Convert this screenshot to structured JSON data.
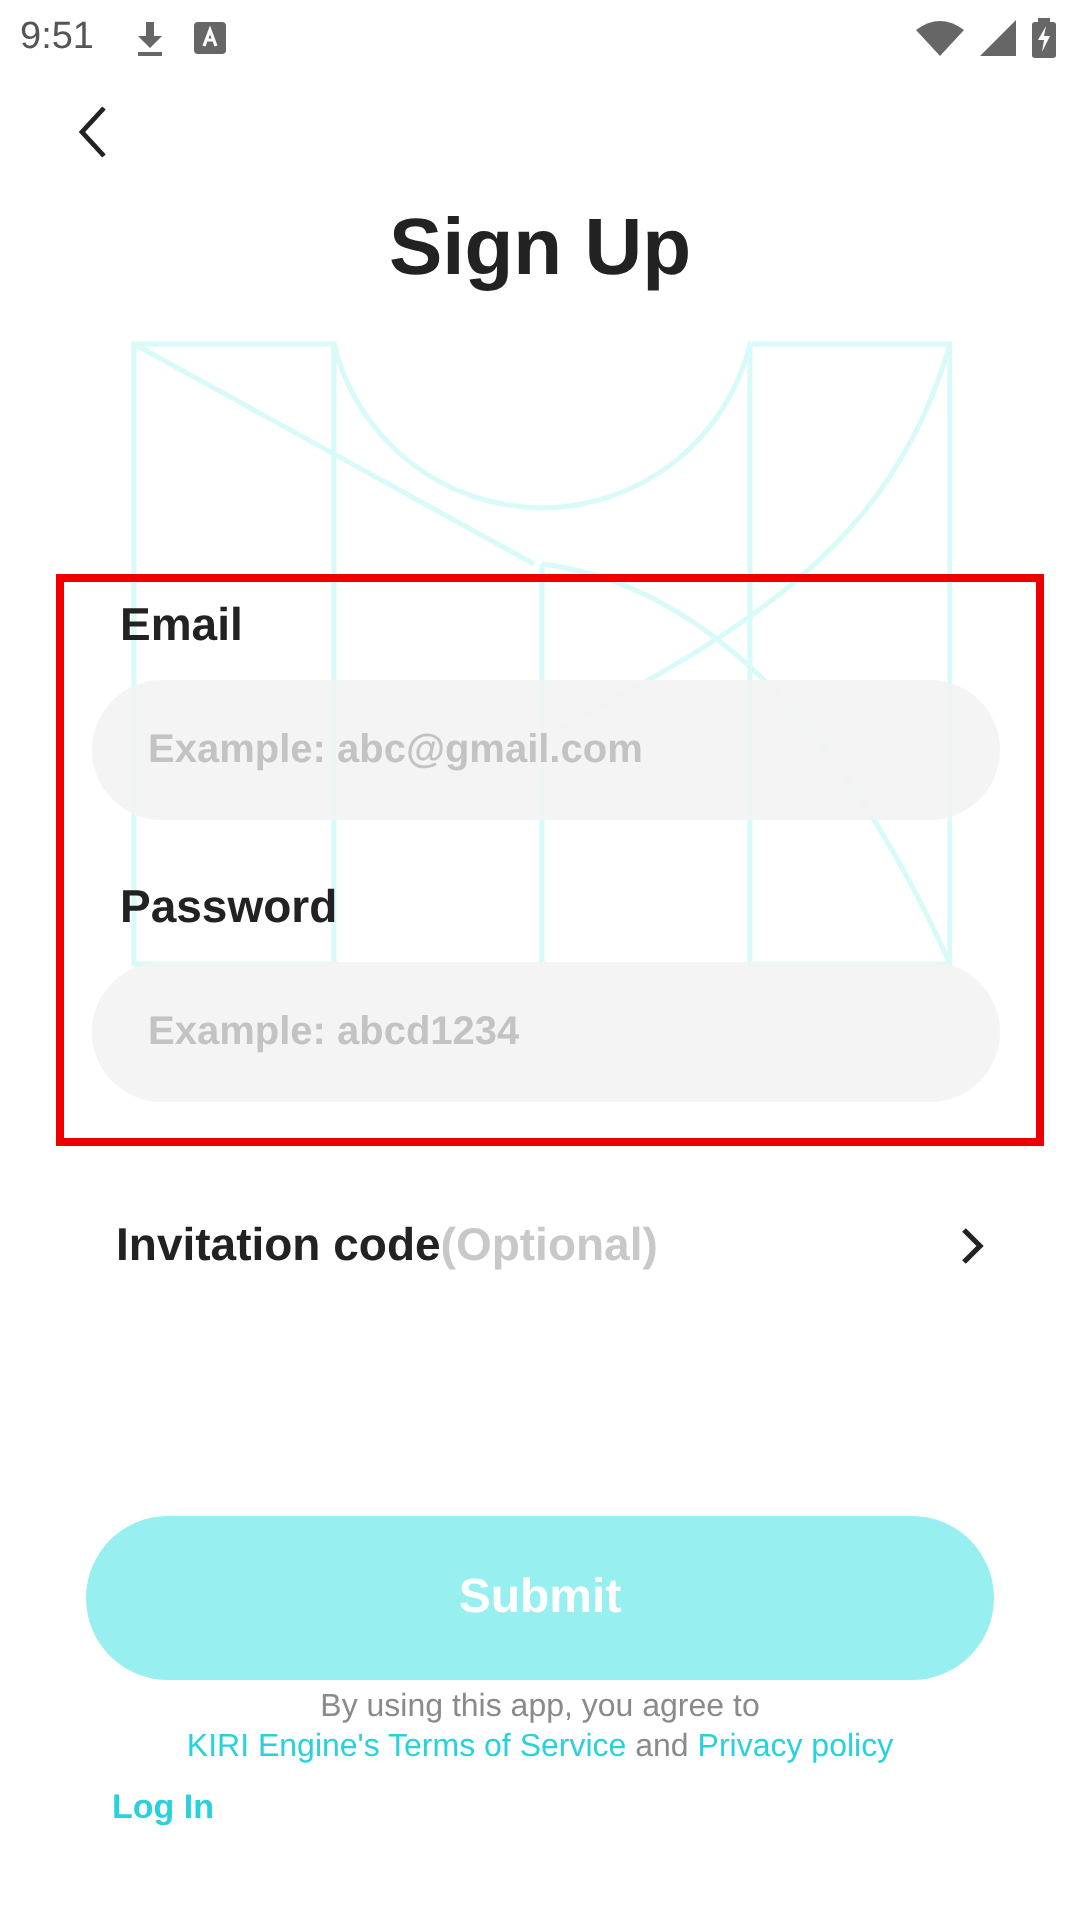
{
  "status_bar": {
    "time": "9:51"
  },
  "title": "Sign Up",
  "form": {
    "highlighted": true,
    "fields": [
      {
        "label": "Email",
        "placeholder": "Example: abc@gmail.com"
      },
      {
        "label": "Password",
        "placeholder": "Example: abcd1234"
      }
    ]
  },
  "invitation": {
    "label": "Invitation code",
    "hint": "(Optional)"
  },
  "submit_button": {
    "label": "Submit",
    "disabled": true
  },
  "terms": [
    {
      "text": "By using this app, you agree to ",
      "kind": "plain"
    },
    {
      "text": "KIRI Engine's Terms of ",
      "kind": "link"
    },
    {
      "text": "Service",
      "kind": "link"
    },
    {
      "text": " and ",
      "kind": "plain"
    },
    {
      "text": "Privacy policy",
      "kind": "link"
    }
  ],
  "login_link": "Log In"
}
